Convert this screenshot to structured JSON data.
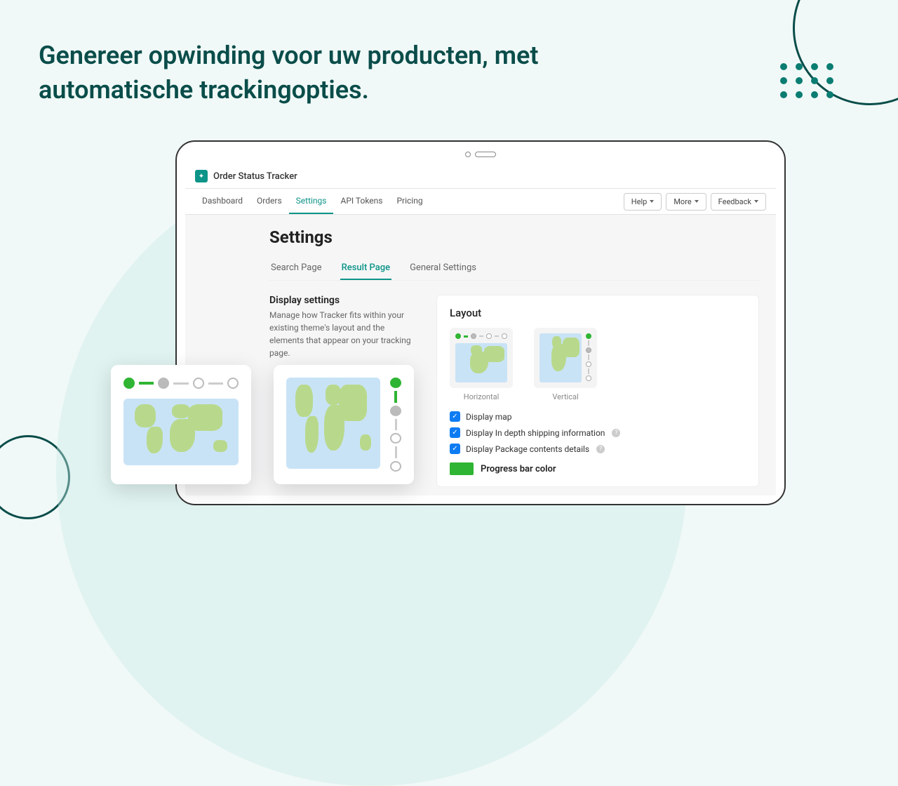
{
  "headline": "Genereer opwinding voor uw producten, met automatische trackingopties.",
  "app": {
    "title": "Order Status Tracker"
  },
  "menu": {
    "items": [
      "Dashboard",
      "Orders",
      "Settings",
      "API Tokens",
      "Pricing"
    ],
    "active": 2,
    "help": "Help",
    "more": "More",
    "feedback": "Feedback"
  },
  "page": {
    "title": "Settings"
  },
  "subtabs": {
    "items": [
      "Search Page",
      "Result Page",
      "General Settings"
    ],
    "active": 1
  },
  "side": {
    "heading": "Display settings",
    "desc": "Manage how Tracker fits within your existing theme's layout and the elements that appear on your tracking page."
  },
  "panel": {
    "heading": "Layout",
    "horizontal": "Horizontal",
    "vertical": "Vertical",
    "checks": [
      {
        "label": "Display map",
        "checked": true,
        "help": false
      },
      {
        "label": "Display In depth shipping information",
        "checked": true,
        "help": true
      },
      {
        "label": "Display Package contents details",
        "checked": true,
        "help": true
      }
    ],
    "color_label": "Progress bar color",
    "color": "#2fb533"
  }
}
